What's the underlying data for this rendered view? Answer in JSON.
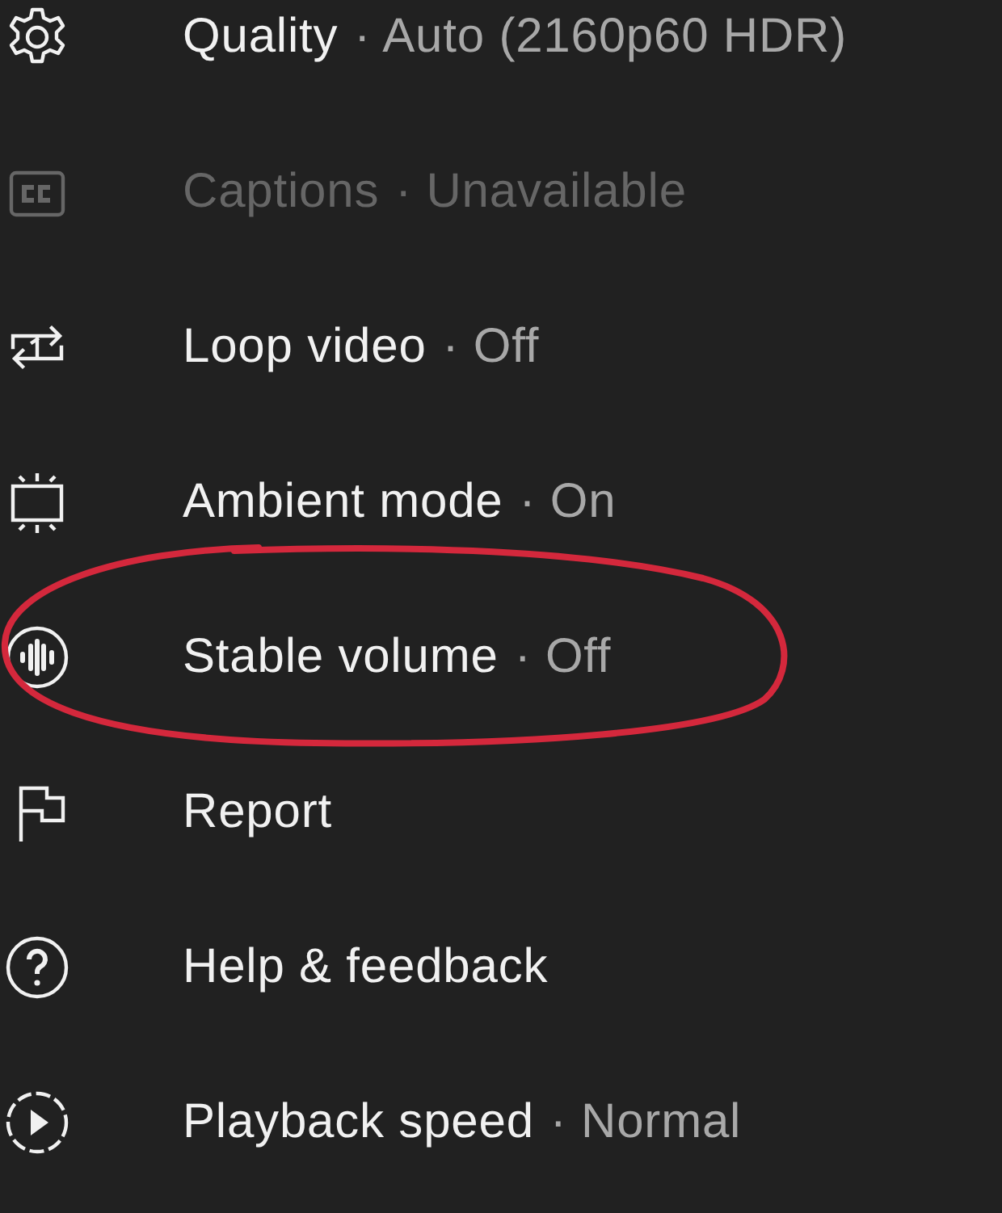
{
  "menu": {
    "items": [
      {
        "kind": "quality",
        "label": "Quality",
        "value": "· Auto (2160p60 HDR)",
        "disabled": false,
        "circled": false
      },
      {
        "kind": "captions",
        "label": "Captions",
        "value": "· Unavailable",
        "disabled": true,
        "circled": false
      },
      {
        "kind": "loop",
        "label": "Loop video",
        "value": "· Off",
        "disabled": false,
        "circled": false
      },
      {
        "kind": "ambient",
        "label": "Ambient mode",
        "value": "· On",
        "disabled": false,
        "circled": false
      },
      {
        "kind": "stable",
        "label": "Stable volume",
        "value": "· Off",
        "disabled": false,
        "circled": true
      },
      {
        "kind": "report",
        "label": "Report",
        "disabled": false,
        "circled": false
      },
      {
        "kind": "help",
        "label": "Help & feedback",
        "disabled": false,
        "circled": false
      },
      {
        "kind": "speed",
        "label": "Playback speed",
        "value": "· Normal",
        "disabled": false,
        "circled": false
      }
    ]
  }
}
